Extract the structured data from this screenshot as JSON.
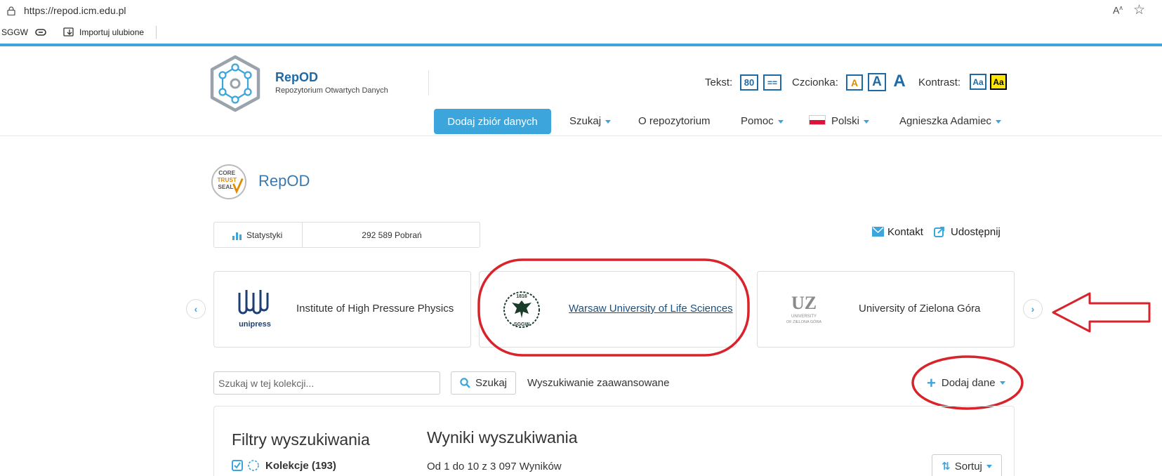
{
  "browser": {
    "url": "https://repod.icm.edu.pl",
    "favorites": {
      "sggw": "SGGW",
      "import": "Importuj ulubione"
    }
  },
  "site": {
    "title": "RepOD",
    "subtitle": "Repozytorium Otwartych Danych",
    "accessibility": {
      "text_label": "Tekst:",
      "text_width_value": "80",
      "text_width_alt": "==",
      "font_label": "Czcionka:",
      "font_glyph": "A",
      "contrast_label": "Kontrast:",
      "contrast_glyph": "Aa"
    },
    "nav": {
      "add_dataset": "Dodaj zbiór danych",
      "search": "Szukaj",
      "about": "O repozytorium",
      "help": "Pomoc",
      "language": "Polski",
      "user": "Agnieszka Adamiec"
    }
  },
  "collection": {
    "badge": [
      "CORE",
      "TRUST",
      "SEAL"
    ],
    "title": "RepOD",
    "stats_label": "Statystyki",
    "downloads": "292 589 Pobrań",
    "contact": "Kontakt",
    "share": "Udostępnij"
  },
  "carousel": {
    "cards": [
      {
        "name": "Institute of High Pressure Physics",
        "logo_text": "unipress"
      },
      {
        "name": "Warsaw University of Life Sciences",
        "logo_top": "1816",
        "logo_bottom": "SGGW"
      },
      {
        "name": "University of Zielona Góra",
        "logo_mark": "UZ",
        "logo_line1": "UNIVERSITY",
        "logo_line2": "OF ZIELONA GÓRA"
      }
    ]
  },
  "search": {
    "placeholder": "Szukaj w tej kolekcji...",
    "button": "Szukaj",
    "advanced": "Wyszukiwanie zaawansowane",
    "add_data": "Dodaj dane"
  },
  "results": {
    "filters_title": "Filtry wyszukiwania",
    "title": "Wyniki wyszukiwania",
    "filter_collections": "Kolekcje (193)",
    "count": "Od 1 do 10 z 3 097 Wyników",
    "sort": "Sortuj"
  },
  "colors": {
    "accent": "#3ba5dc",
    "brand": "#1e6aa6",
    "annotation": "#d9232b"
  }
}
